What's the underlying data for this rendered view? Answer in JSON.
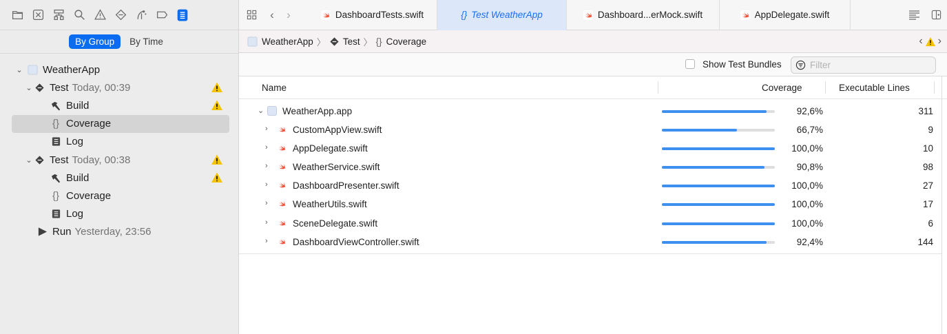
{
  "navigator": {
    "toolbar_icons": [
      "folder-icon",
      "source-control-icon",
      "symbol-hierarchy-icon",
      "search-icon",
      "issue-warning-icon",
      "test-diamond-icon",
      "debug-icon",
      "breakpoint-icon",
      "report-icon"
    ],
    "segment": {
      "by_group": "By Group",
      "by_time": "By Time"
    },
    "tree": {
      "project": "WeatherApp",
      "test1": {
        "label": "Test",
        "time": "Today, 00:39"
      },
      "test1_build": "Build",
      "test1_coverage": "Coverage",
      "test1_log": "Log",
      "test2": {
        "label": "Test",
        "time": "Today, 00:38"
      },
      "test2_build": "Build",
      "test2_coverage": "Coverage",
      "test2_log": "Log",
      "run": {
        "label": "Run",
        "time": "Yesterday, 23:56"
      }
    }
  },
  "tabs": {
    "t1": "DashboardTests.swift",
    "t2": "Test WeatherApp",
    "t3": "Dashboard...erMock.swift",
    "t4": "AppDelegate.swift"
  },
  "jumpbar": {
    "project": "WeatherApp",
    "test": "Test",
    "coverage": "Coverage"
  },
  "filterbar": {
    "show_bundles": "Show Test Bundles",
    "filter_placeholder": "Filter"
  },
  "columns": {
    "name": "Name",
    "coverage": "Coverage",
    "lines": "Executable Lines"
  },
  "colors": {
    "accent": "#0a6cf0",
    "bar_fill": "#3d8ff0",
    "warning": "#f5c400"
  },
  "files": [
    {
      "name": "WeatherApp.app",
      "pct": "92,6%",
      "fraction": 0.926,
      "lines": "311"
    },
    {
      "name": "CustomAppView.swift",
      "pct": "66,7%",
      "fraction": 0.667,
      "lines": "9"
    },
    {
      "name": "AppDelegate.swift",
      "pct": "100,0%",
      "fraction": 1.0,
      "lines": "10"
    },
    {
      "name": "WeatherService.swift",
      "pct": "90,8%",
      "fraction": 0.908,
      "lines": "98"
    },
    {
      "name": "DashboardPresenter.swift",
      "pct": "100,0%",
      "fraction": 1.0,
      "lines": "27"
    },
    {
      "name": "WeatherUtils.swift",
      "pct": "100,0%",
      "fraction": 1.0,
      "lines": "17"
    },
    {
      "name": "SceneDelegate.swift",
      "pct": "100,0%",
      "fraction": 1.0,
      "lines": "6"
    },
    {
      "name": "DashboardViewController.swift",
      "pct": "92,4%",
      "fraction": 0.924,
      "lines": "144"
    }
  ]
}
